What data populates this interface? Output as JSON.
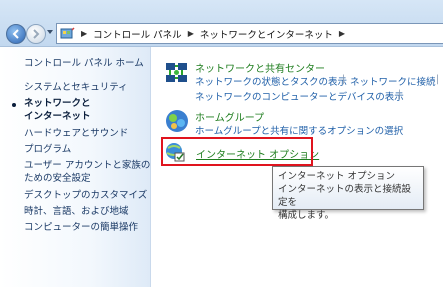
{
  "address_bar": {
    "breadcrumbs": [
      "コントロール パネル",
      "ネットワークとインターネット"
    ]
  },
  "sidebar": {
    "items": [
      {
        "label": "コントロール パネル ホーム"
      },
      {
        "label": "システムとセキュリティ"
      },
      {
        "label": "ネットワークと",
        "label2": "インターネット",
        "current": true
      },
      {
        "label": "ハードウェアとサウンド"
      },
      {
        "label": "プログラム"
      },
      {
        "label": "ユーザー アカウントと家族の",
        "label2": "ための安全設定"
      },
      {
        "label": "デスクトップのカスタマイズ"
      },
      {
        "label": "時計、言語、および地域"
      },
      {
        "label": "コンピューターの簡単操作"
      }
    ]
  },
  "categories": {
    "network_center": {
      "title": "ネットワークと共有センター",
      "links_row1": [
        "ネットワークの状態とタスクの表示",
        "ネットワークに接続"
      ],
      "links_row2": [
        "ネットワークのコンピューターとデバイスの表示"
      ]
    },
    "homegroup": {
      "title": "ホームグループ",
      "links_row1": [
        "ホームグループと共有に関するオプションの選択"
      ]
    },
    "internet_options": {
      "title": "インターネット オプション"
    }
  },
  "tooltip": {
    "title": "インターネット オプション",
    "line1": "インターネットの表示と接続設定を",
    "line2": "構成します。"
  },
  "colors": {
    "highlight_border": "#e0141e",
    "category_title": "#1e7d1e",
    "link": "#1f5fa8"
  }
}
